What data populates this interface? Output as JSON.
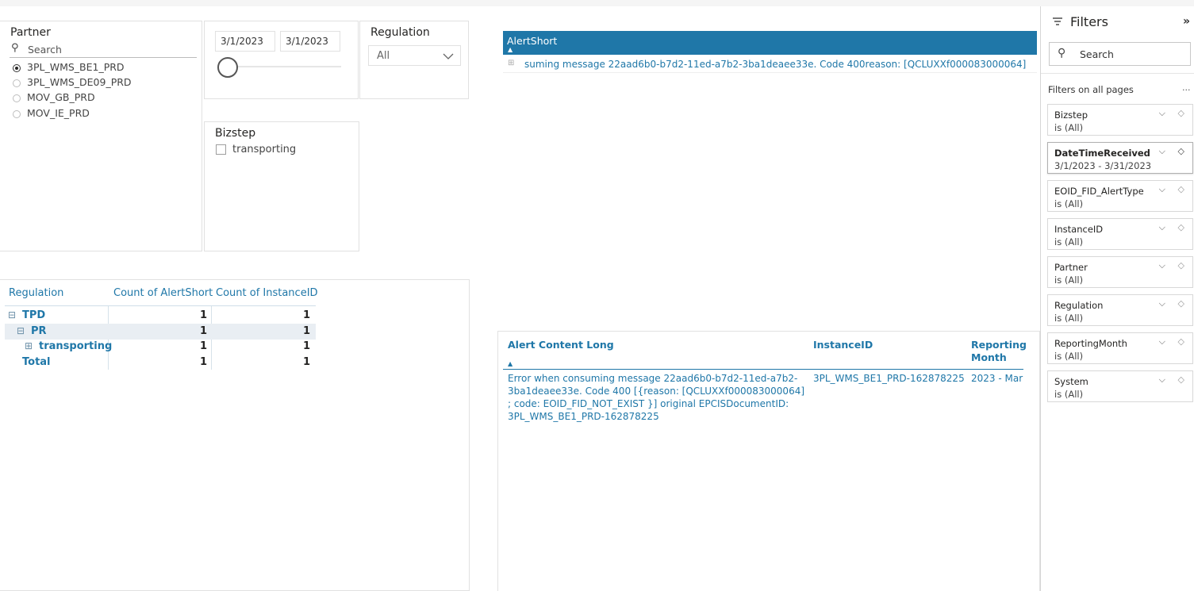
{
  "partner_slicer": {
    "title": "Partner",
    "search_placeholder": "Search",
    "items": [
      {
        "label": "3PL_WMS_BE1_PRD",
        "selected": true
      },
      {
        "label": "3PL_WMS_DE09_PRD",
        "selected": false
      },
      {
        "label": "MOV_GB_PRD",
        "selected": false
      },
      {
        "label": "MOV_IE_PRD",
        "selected": false
      }
    ]
  },
  "date_slicer": {
    "start": "3/1/2023",
    "end": "3/1/2023"
  },
  "regulation_slicer": {
    "title": "Regulation",
    "selected": "All"
  },
  "bizstep_slicer": {
    "title": "Bizstep",
    "items": [
      {
        "label": "transporting"
      }
    ]
  },
  "matrix": {
    "headers": [
      "Regulation",
      "Count of AlertShort",
      "Count of InstanceID"
    ],
    "rows": [
      {
        "label": "TPD",
        "expand": "⊟",
        "c1": "1",
        "c2": "1"
      },
      {
        "label": "PR",
        "expand": "⊟",
        "c1": "1",
        "c2": "1"
      },
      {
        "label": "transporting",
        "expand": "⊞",
        "c1": "1",
        "c2": "1"
      },
      {
        "label": "Total",
        "expand": "",
        "c1": "1",
        "c2": "1"
      }
    ]
  },
  "alert_short": {
    "header": "AlertShort",
    "row": "suming message 22aad6b0-b7d2-11ed-a7b2-3ba1deaee33e. Code 400reason: [QCLUXXf000083000064]"
  },
  "detail_table": {
    "headers": {
      "alert": "Alert Content Long",
      "instance": "InstanceID",
      "month": "Reporting Month"
    },
    "rows": [
      {
        "alert": "Error when consuming message 22aad6b0-b7d2-11ed-a7b2-3ba1deaee33e. Code 400 [{reason: [QCLUXXf000083000064] ; code: EOID_FID_NOT_EXIST }] original EPCISDocumentID: 3PL_WMS_BE1_PRD-162878225",
        "instance": "3PL_WMS_BE1_PRD-162878225",
        "month": "2023 - Mar"
      }
    ]
  },
  "filters_pane": {
    "title": "Filters",
    "search_placeholder": "Search",
    "section_label": "Filters on all pages",
    "more": "...",
    "cards": [
      {
        "name": "Bizstep",
        "value": "is (All)",
        "bold": false
      },
      {
        "name": "DateTimeReceived",
        "value": "3/1/2023 - 3/31/2023",
        "bold": true
      },
      {
        "name": "EOID_FID_AlertType",
        "value": "is (All)",
        "bold": false
      },
      {
        "name": "InstanceID",
        "value": "is (All)",
        "bold": false
      },
      {
        "name": "Partner",
        "value": "is (All)",
        "bold": false
      },
      {
        "name": "Regulation",
        "value": "is (All)",
        "bold": false
      },
      {
        "name": "ReportingMonth",
        "value": "is (All)",
        "bold": false
      },
      {
        "name": "System",
        "value": "is (All)",
        "bold": false
      }
    ]
  },
  "colors": {
    "accent": "#1f77a8",
    "header_bg": "#1f77a8"
  }
}
